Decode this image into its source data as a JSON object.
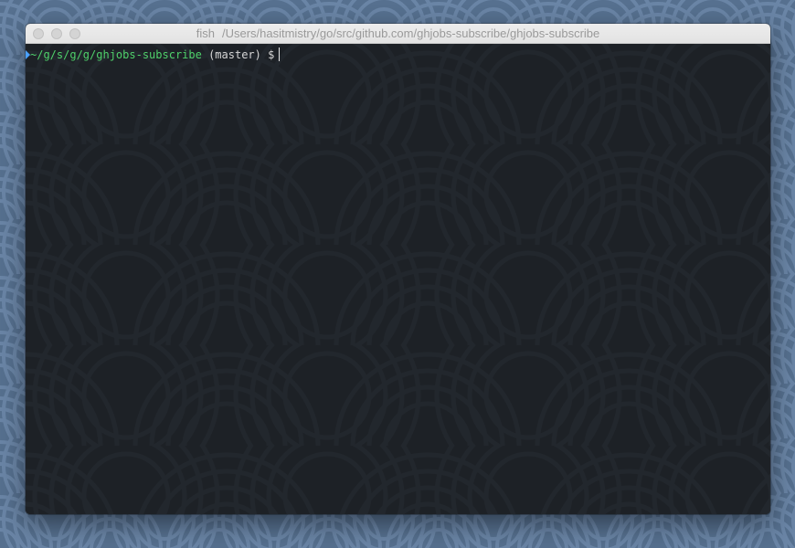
{
  "window": {
    "process_name": "fish",
    "title_path": "/Users/hasitmistry/go/src/github.com/ghjobs-subscribe/ghjobs-subscribe"
  },
  "terminal": {
    "prompt_path": "~/g/s/g/g/ghjobs-subscribe",
    "prompt_branch": "(master)",
    "prompt_symbol": "$",
    "input_value": ""
  },
  "colors": {
    "desktop_bg": "#5a7596",
    "terminal_bg": "#1d2126",
    "prompt_path": "#4fd16b",
    "prompt_arrow": "#4aa0ff",
    "prompt_text": "#d6d6d6"
  },
  "icons": [
    "close-button",
    "minimize-button",
    "zoom-button",
    "prompt-arrow-icon"
  ]
}
